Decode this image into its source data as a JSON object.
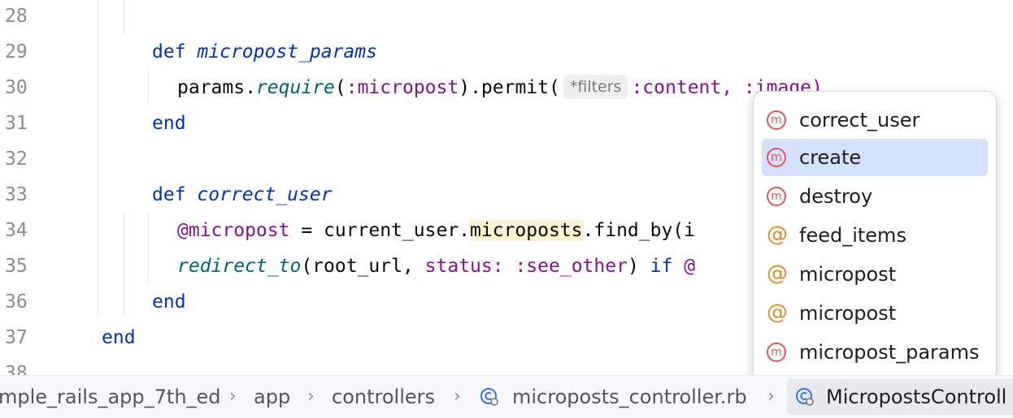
{
  "editor": {
    "line_numbers": [
      "28",
      "29",
      "30",
      "31",
      "32",
      "33",
      "34",
      "35",
      "36",
      "37",
      "38"
    ],
    "lines": {
      "l29_kw": "def",
      "l29_name": "micropost_params",
      "l30_a": "params.",
      "l30_b": "require",
      "l30_c": "(",
      "l30_d": ":micropost",
      "l30_e": ").permit(",
      "l30_hint": "*filters",
      "l30_f": ":content, :image)",
      "l31": "end",
      "l33_kw": "def",
      "l33_name": "correct_user",
      "l34_a": "@micropost",
      "l34_b": " = current_user.",
      "l34_c": "microposts",
      "l34_d": ".find_by(i",
      "l35_a": "redirect_to",
      "l35_b": "(root_url, ",
      "l35_c": "status:",
      "l35_d": " ",
      "l35_e": ":see_other",
      "l35_f": ") ",
      "l35_g": "if",
      "l35_h": " @",
      "l36": "end",
      "l37": "end"
    }
  },
  "completion": {
    "items": [
      {
        "label": "correct_user",
        "icon": "m",
        "selected": false
      },
      {
        "label": "create",
        "icon": "m",
        "selected": true
      },
      {
        "label": "destroy",
        "icon": "m",
        "selected": false
      },
      {
        "label": "feed_items",
        "icon": "@",
        "selected": false
      },
      {
        "label": "micropost",
        "icon": "@",
        "selected": false
      },
      {
        "label": "micropost",
        "icon": "@",
        "selected": false
      },
      {
        "label": "micropost_params",
        "icon": "m",
        "selected": false
      }
    ]
  },
  "breadcrumbs": {
    "items": [
      "mple_rails_app_7th_ed",
      "app",
      "controllers",
      "microposts_controller.rb",
      "MicropostsControll"
    ],
    "separator": "›"
  },
  "colors": {
    "keyword": "#0033b3",
    "symbol": "#871094",
    "method_call": "#00627a",
    "selection": "#d5e1fb",
    "method_icon": "#e05555",
    "field_icon": "#e8862a"
  }
}
